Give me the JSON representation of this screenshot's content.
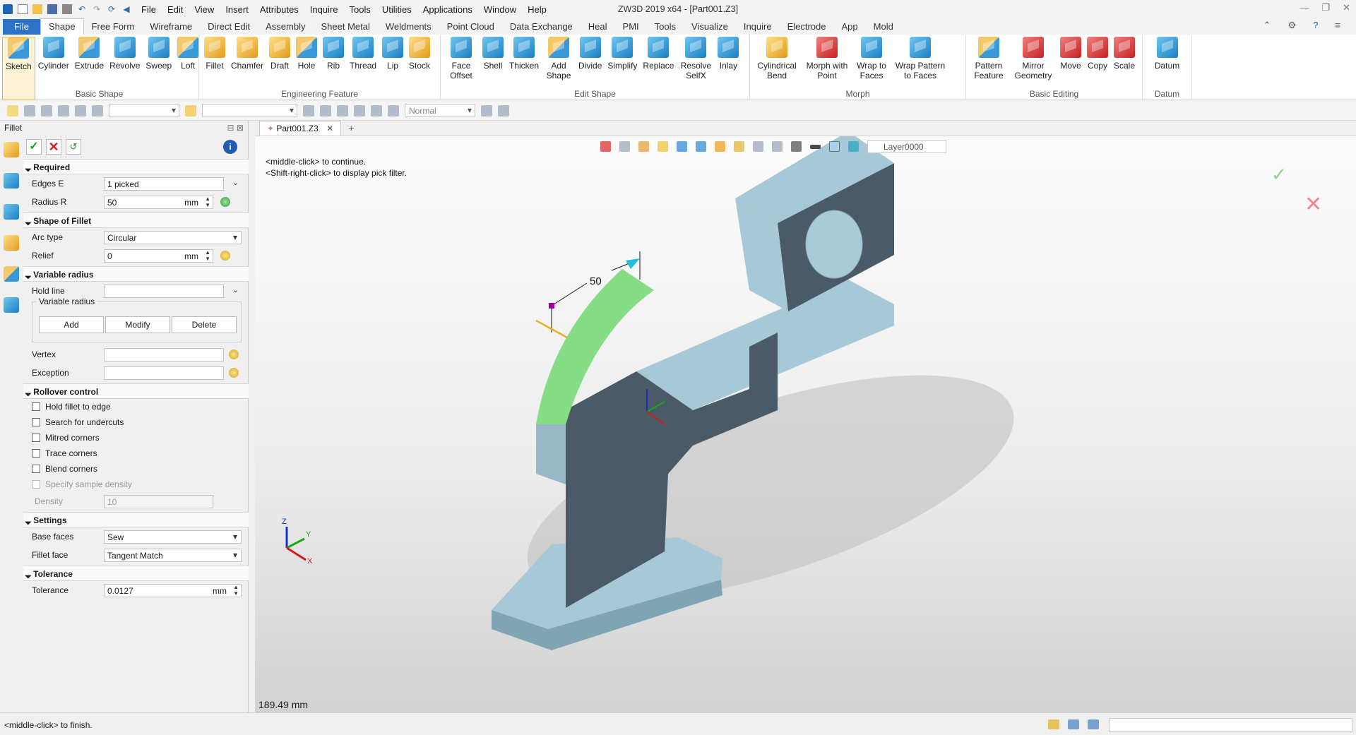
{
  "app": {
    "title": "ZW3D 2019  x64 - [Part001.Z3]"
  },
  "menu": [
    "File",
    "Edit",
    "View",
    "Insert",
    "Attributes",
    "Inquire",
    "Tools",
    "Utilities",
    "Applications",
    "Window",
    "Help"
  ],
  "tabs": [
    "File",
    "Shape",
    "Free Form",
    "Wireframe",
    "Direct Edit",
    "Assembly",
    "Sheet Metal",
    "Weldments",
    "Point Cloud",
    "Data Exchange",
    "Heal",
    "PMI",
    "Tools",
    "Visualize",
    "Inquire",
    "Electrode",
    "App",
    "Mold"
  ],
  "ribbon": {
    "basic_shape": {
      "name": "Basic Shape",
      "items": [
        "Sketch",
        "Cylinder",
        "Extrude",
        "Revolve",
        "Sweep",
        "Loft"
      ]
    },
    "engineering": {
      "name": "Engineering Feature",
      "items": [
        "Fillet",
        "Chamfer",
        "Draft",
        "Hole",
        "Rib",
        "Thread",
        "Lip",
        "Stock"
      ]
    },
    "edit_shape": {
      "name": "Edit Shape",
      "items": [
        "Face Offset",
        "Shell",
        "Thicken",
        "Add Shape",
        "Divide",
        "Simplify",
        "Replace",
        "Resolve SelfX",
        "Inlay"
      ]
    },
    "morph": {
      "name": "Morph",
      "items": [
        "Cylindrical Bend",
        "Morph with Point",
        "Wrap to Faces",
        "Wrap Pattern to Faces"
      ]
    },
    "basic_editing": {
      "name": "Basic Editing",
      "items": [
        "Pattern Feature",
        "Mirror Geometry",
        "Move",
        "Copy",
        "Scale"
      ]
    },
    "datum": {
      "name": "Datum",
      "items": [
        "Datum"
      ]
    }
  },
  "toolbar": {
    "render_mode": "Normal"
  },
  "panel": {
    "title": "Fillet",
    "required": {
      "title": "Required",
      "edges_label": "Edges E",
      "edges_value": "1 picked",
      "radius_label": "Radius R",
      "radius_value": "50",
      "unit": "mm"
    },
    "shape": {
      "title": "Shape of Fillet",
      "arc_label": "Arc type",
      "arc_value": "Circular",
      "relief_label": "Relief",
      "relief_value": "0",
      "unit": "mm"
    },
    "variable": {
      "title": "Variable radius",
      "hold_label": "Hold line",
      "group_label": "Variable radius",
      "add": "Add",
      "modify": "Modify",
      "delete": "Delete",
      "vertex_label": "Vertex",
      "exception_label": "Exception"
    },
    "rollover": {
      "title": "Rollover control",
      "options": [
        "Hold fillet to edge",
        "Search for undercuts",
        "Mitred corners",
        "Trace corners",
        "Blend corners",
        "Specify sample density"
      ],
      "density_label": "Density",
      "density_value": "10"
    },
    "settings": {
      "title": "Settings",
      "base_label": "Base faces",
      "base_value": "Sew",
      "fillet_label": "Fillet face",
      "fillet_value": "Tangent Match"
    },
    "tolerance": {
      "title": "Tolerance",
      "label": "Tolerance",
      "value": "0.0127",
      "unit": "mm"
    }
  },
  "document": {
    "tab": "Part001.Z3"
  },
  "viewport": {
    "prompt_line1": "<middle-click> to continue.",
    "prompt_line2": "<Shift-right-click> to display pick filter.",
    "layer": "Layer0000",
    "dimension": "50",
    "distance": "189.49 mm",
    "axes": {
      "x": "X",
      "y": "Y",
      "z": "Z"
    }
  },
  "status": {
    "text": "<middle-click> to finish."
  }
}
